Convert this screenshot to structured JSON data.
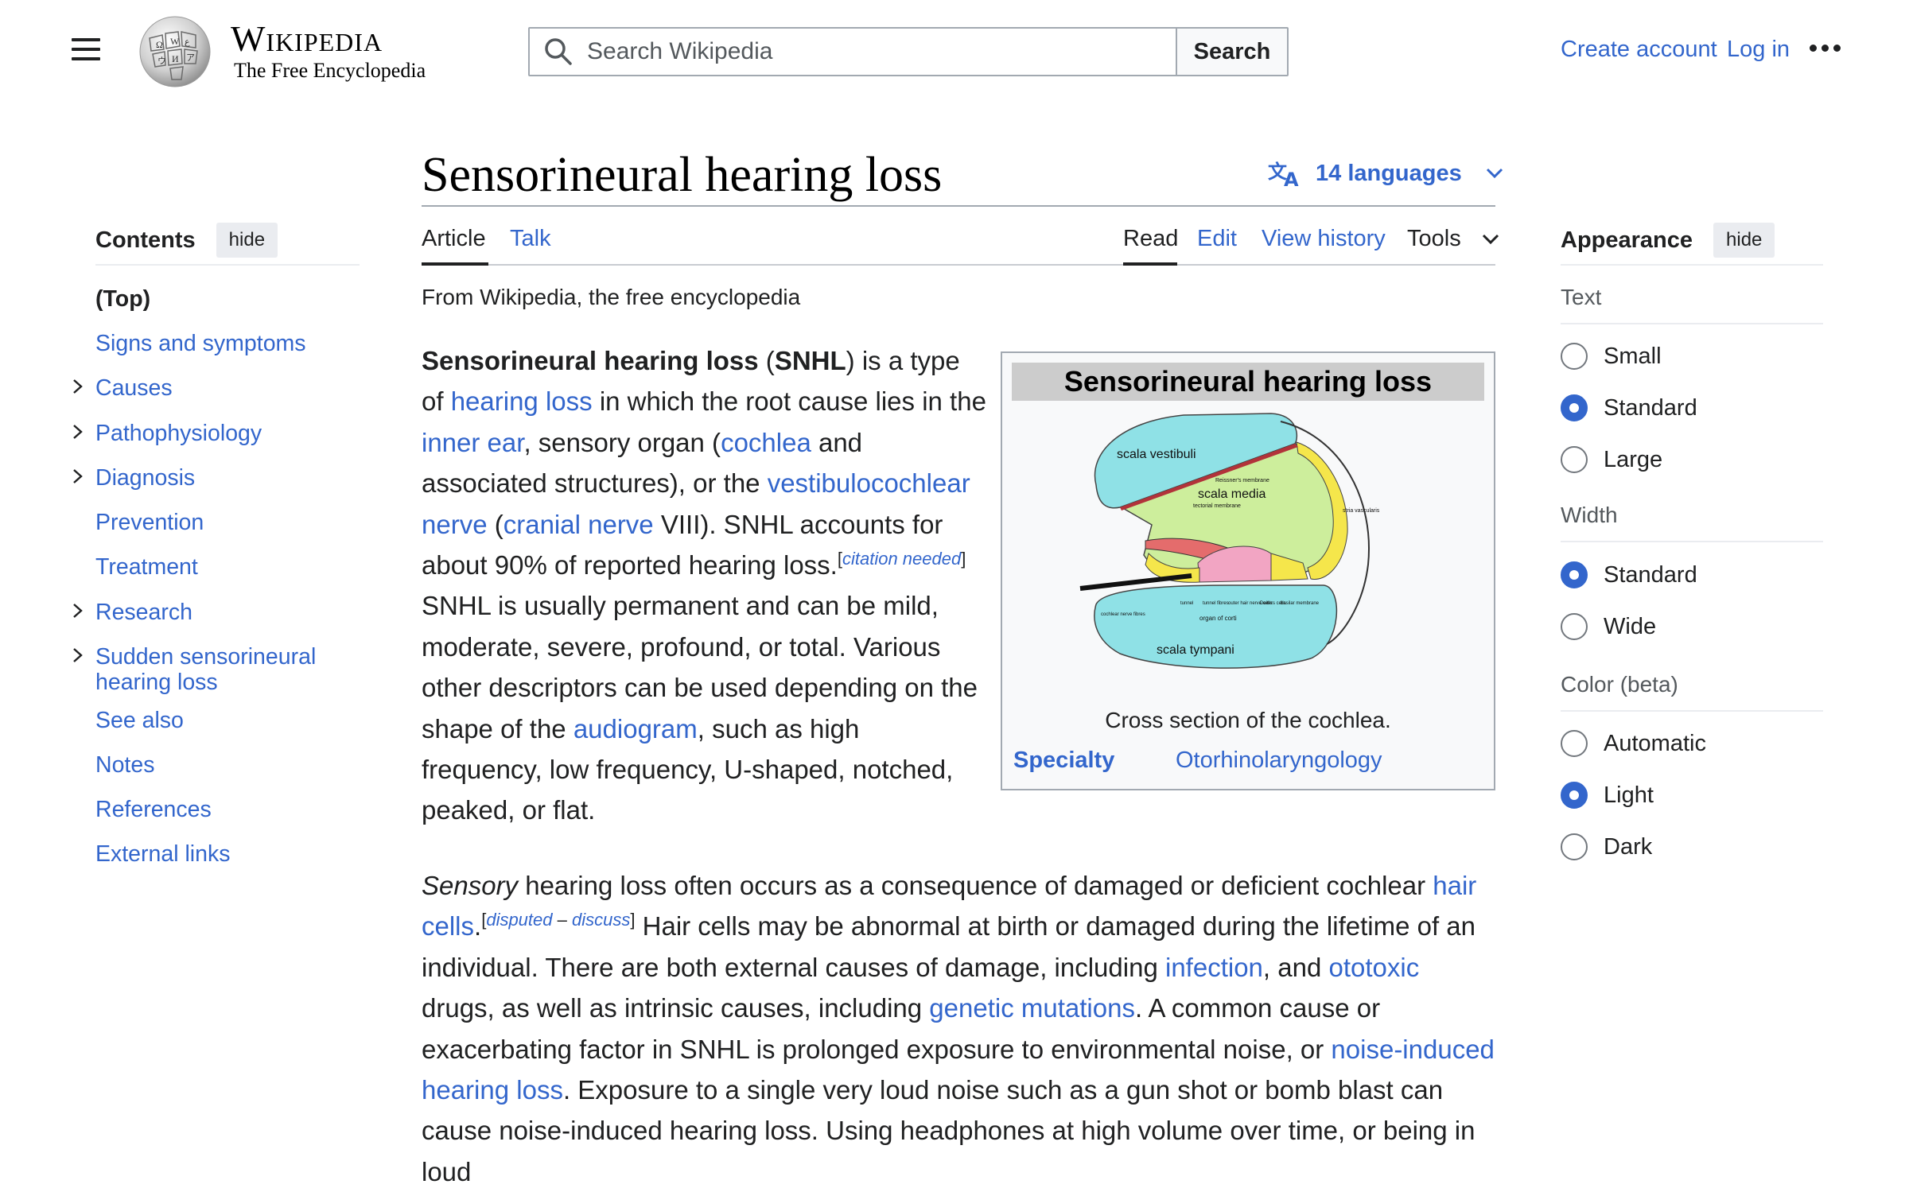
{
  "header": {
    "wordmark_main": "Wikipedia",
    "wordmark_tagline": "The Free Encyclopedia",
    "search_placeholder": "Search Wikipedia",
    "search_button": "Search",
    "create_account": "Create account",
    "log_in": "Log in"
  },
  "article": {
    "title": "Sensorineural hearing loss",
    "languages_label": "14 languages",
    "tabs": {
      "article": "Article",
      "talk": "Talk",
      "read": "Read",
      "edit": "Edit",
      "view_history": "View history",
      "tools": "Tools"
    },
    "from_line": "From Wikipedia, the free encyclopedia"
  },
  "toc": {
    "heading": "Contents",
    "hide": "hide",
    "items": [
      {
        "label": "(Top)",
        "expandable": false
      },
      {
        "label": "Signs and symptoms",
        "expandable": false
      },
      {
        "label": "Causes",
        "expandable": true
      },
      {
        "label": "Pathophysiology",
        "expandable": true
      },
      {
        "label": "Diagnosis",
        "expandable": true
      },
      {
        "label": "Prevention",
        "expandable": false
      },
      {
        "label": "Treatment",
        "expandable": false
      },
      {
        "label": "Research",
        "expandable": true
      },
      {
        "label": "Sudden sensorineural hearing loss",
        "expandable": true
      },
      {
        "label": "See also",
        "expandable": false
      },
      {
        "label": "Notes",
        "expandable": false
      },
      {
        "label": "References",
        "expandable": false
      },
      {
        "label": "External links",
        "expandable": false
      }
    ]
  },
  "infobox": {
    "title": "Sensorineural hearing loss",
    "caption": "Cross section of the cochlea.",
    "specialty_label": "Specialty",
    "specialty_value": "Otorhinolaryngology",
    "diagram_labels": {
      "scala_vestibuli": "scala vestibuli",
      "scala_media": "scala media",
      "scala_tympani": "scala tympani",
      "reissner": "Reissner's membrane",
      "tectorial": "tectorial membrane",
      "stria": "stria vascularis",
      "cochlear_nerve": "cochlear nerve fibres",
      "organ_of_corti": "organ of corti",
      "tunnel": "tunnel",
      "tunnel_fibres": "tunnel fibres",
      "outer_hair": "outer hair nerve cells",
      "deiters": "Deiters cells",
      "basilar": "basilar membrane"
    }
  },
  "paragraph1": {
    "b1": "Sensorineural hearing loss",
    "t1": " (",
    "b2": "SNHL",
    "t2": ") is a type of ",
    "l_hearing_loss": "hearing loss",
    "t3": " in which the root cause lies in the ",
    "l_inner_ear": "inner ear",
    "t4": ", sensory organ (",
    "l_cochlea": "cochlea",
    "t5": " and associated structures), or the ",
    "l_vestibulo": "vestibulocochlear nerve",
    "t6": " (",
    "l_cranial": "cranial nerve",
    "t7": " VIII). SNHL accounts for about 90% of reported hearing loss.",
    "cite_open": "[",
    "cite": "citation needed",
    "cite_close": "]",
    "t8": " SNHL is usually permanent and can be mild, moderate, severe, profound, or total. Various other descriptors can be used depending on the shape of the ",
    "l_audiogram": "audiogram",
    "t9": ", such as high frequency, low frequency, U-shaped, notched, peaked, or flat."
  },
  "paragraph2": {
    "i1": "Sensory",
    "t1": " hearing loss often occurs as a consequence of damaged or deficient cochlear ",
    "l_hair": "hair cells",
    "t2": ".",
    "sup_open": "[",
    "sup_disputed": "disputed",
    "sup_dash": " – ",
    "sup_discuss": "discuss",
    "sup_close": "]",
    "t3": " Hair cells may be abnormal at birth or damaged during the lifetime of an individual. There are both external causes of damage, including ",
    "l_infection": "infection",
    "t4": ", and ",
    "l_ototoxic": "ototoxic",
    "t5": " drugs, as well as intrinsic causes, including ",
    "l_genetic": "genetic mutations",
    "t6": ". A common cause or exacerbating factor in SNHL is prolonged exposure to environmental noise, or ",
    "l_noise": "noise-induced hearing loss",
    "t7": ". Exposure to a single very loud noise such as a gun shot or bomb blast can cause noise-induced hearing loss. Using headphones at high volume over time, or being in loud"
  },
  "appearance": {
    "heading": "Appearance",
    "hide": "hide",
    "text_label": "Text",
    "text_options": [
      {
        "label": "Small",
        "selected": false
      },
      {
        "label": "Standard",
        "selected": true
      },
      {
        "label": "Large",
        "selected": false
      }
    ],
    "width_label": "Width",
    "width_options": [
      {
        "label": "Standard",
        "selected": true
      },
      {
        "label": "Wide",
        "selected": false
      }
    ],
    "color_label": "Color (beta)",
    "color_options": [
      {
        "label": "Automatic",
        "selected": false
      },
      {
        "label": "Light",
        "selected": true
      },
      {
        "label": "Dark",
        "selected": false
      }
    ]
  },
  "colors": {
    "link": "#3366cc",
    "text": "#202122",
    "radio_selected": "#3366cc"
  }
}
